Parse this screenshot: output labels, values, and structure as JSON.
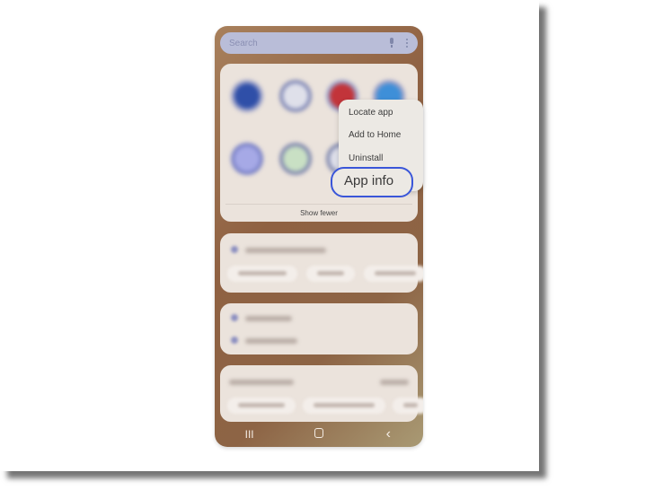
{
  "search": {
    "placeholder": "Search",
    "mic_icon": "microphone-icon",
    "more_icon": "more-vertical-icon"
  },
  "apps_panel": {
    "icons": [
      {
        "name": "app-icon-1",
        "color": "#2f4fa8"
      },
      {
        "name": "app-icon-2",
        "color": "#7f86b4"
      },
      {
        "name": "app-icon-3",
        "color": "#c2343a"
      },
      {
        "name": "app-icon-4",
        "color": "#3e8fd8"
      },
      {
        "name": "app-icon-5",
        "color": "#7880c6"
      },
      {
        "name": "app-icon-6",
        "color": "#7e86ad"
      },
      {
        "name": "app-icon-7",
        "color": "#7e86ad"
      }
    ],
    "show_fewer_label": "Show fewer"
  },
  "context_menu": {
    "items": [
      "Locate app",
      "Add to Home",
      "Uninstall"
    ],
    "highlighted_item": "App info",
    "highlight_color": "#3a56d9"
  },
  "nav_bar": {
    "recents_icon": "III",
    "home_icon": "home-icon",
    "back_icon": "‹"
  }
}
